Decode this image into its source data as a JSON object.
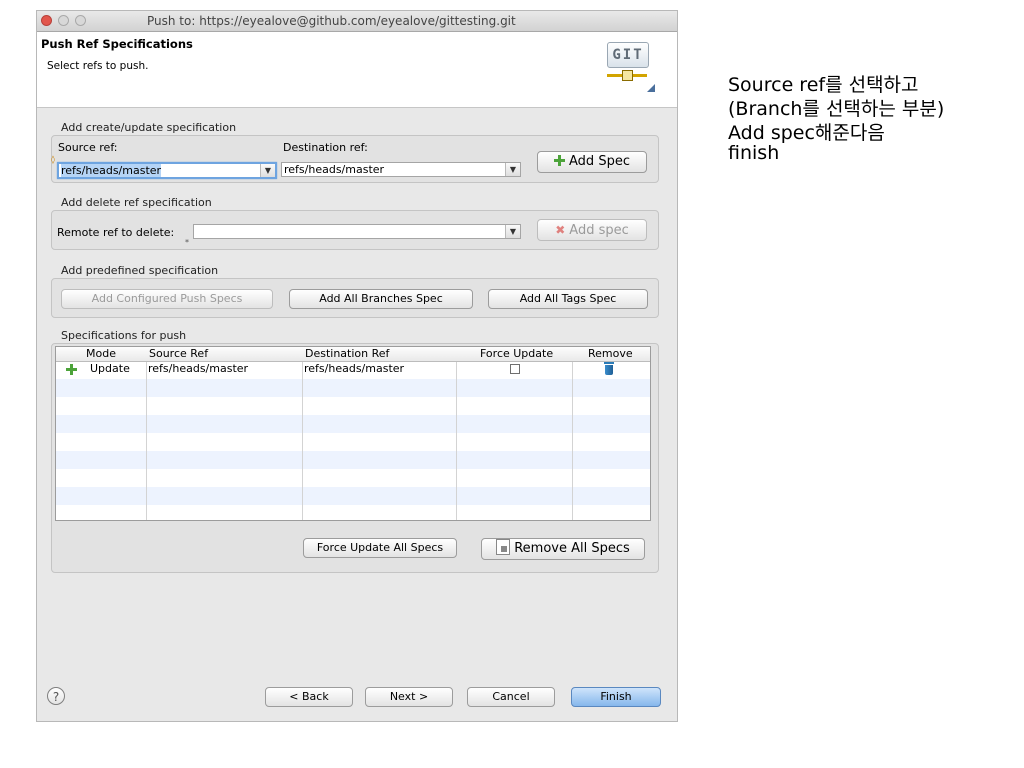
{
  "window": {
    "title": "Push to: https://eyealove@github.com/eyealove/gittesting.git"
  },
  "header": {
    "title": "Push Ref Specifications",
    "subtitle": "Select refs to push.",
    "logo_text": "GIT"
  },
  "create_update": {
    "group_label": "Add create/update specification",
    "source_label": "Source ref:",
    "source_value": "refs/heads/master",
    "destination_label": "Destination ref:",
    "destination_value": "refs/heads/master",
    "add_button": "Add Spec"
  },
  "delete_ref": {
    "group_label": "Add delete ref specification",
    "remote_label": "Remote ref to delete:",
    "remote_value": "",
    "add_button": "Add spec"
  },
  "predefined": {
    "group_label": "Add predefined specification",
    "buttons": [
      "Add Configured Push Specs",
      "Add All Branches Spec",
      "Add All Tags Spec"
    ]
  },
  "specs": {
    "group_label": "Specifications for push",
    "columns": [
      "Mode",
      "Source Ref",
      "Destination Ref",
      "Force Update",
      "Remove"
    ],
    "rows": [
      {
        "mode": "Update",
        "source": "refs/heads/master",
        "destination": "refs/heads/master",
        "force_update": false
      }
    ],
    "force_all_button": "Force Update All Specs",
    "remove_all_button": "Remove All Specs"
  },
  "footer": {
    "help": "?",
    "back": "< Back",
    "next": "Next >",
    "cancel": "Cancel",
    "finish": "Finish"
  },
  "annotation": {
    "lines": [
      "Source ref를 선택하고",
      "(Branch를 선택하는 부분)",
      "Add spec해준다음",
      "finish"
    ]
  },
  "colors": {
    "window_bg": "#e8e8e8",
    "default_button": "#86b7ec",
    "add_icon": "#4ca33a",
    "stripe": "#edf3fe"
  }
}
